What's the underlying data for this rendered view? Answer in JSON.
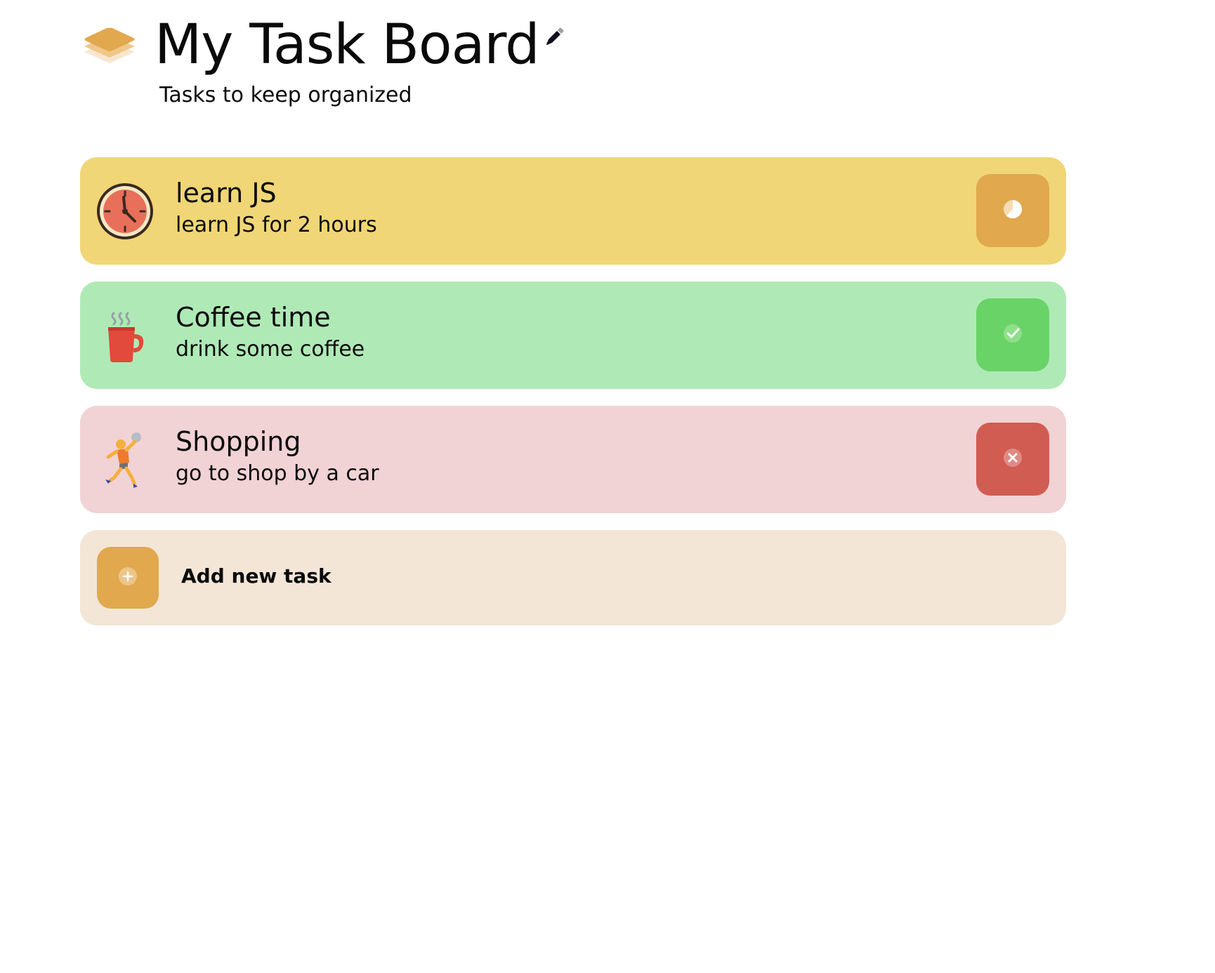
{
  "header": {
    "title": "My Task Board",
    "subtitle": "Tasks to keep organized",
    "logo_icon": "stacked-layers-icon",
    "edit_icon": "pencil-icon"
  },
  "tasks": [
    {
      "title": "learn JS",
      "description": "learn JS for 2 hours",
      "icon": "alarm-clock-icon",
      "status": "in-progress",
      "status_icon": "progress-clock-icon",
      "card_color": "#f0d676",
      "status_color": "#e1a84e"
    },
    {
      "title": "Coffee time",
      "description": "drink some coffee",
      "icon": "hot-coffee-icon",
      "status": "completed",
      "status_icon": "checkmark-icon",
      "card_color": "#afeab6",
      "status_color": "#6ad367"
    },
    {
      "title": "Shopping",
      "description": "go to shop by a car",
      "icon": "person-playing-handball-icon",
      "status": "wont-do",
      "status_icon": "close-icon",
      "card_color": "#f1d3d5",
      "status_color": "#d15c52"
    }
  ],
  "add_task": {
    "label": "Add new task",
    "icon": "plus-icon",
    "card_color": "#f3e6d6",
    "button_color": "#e1a84e"
  }
}
